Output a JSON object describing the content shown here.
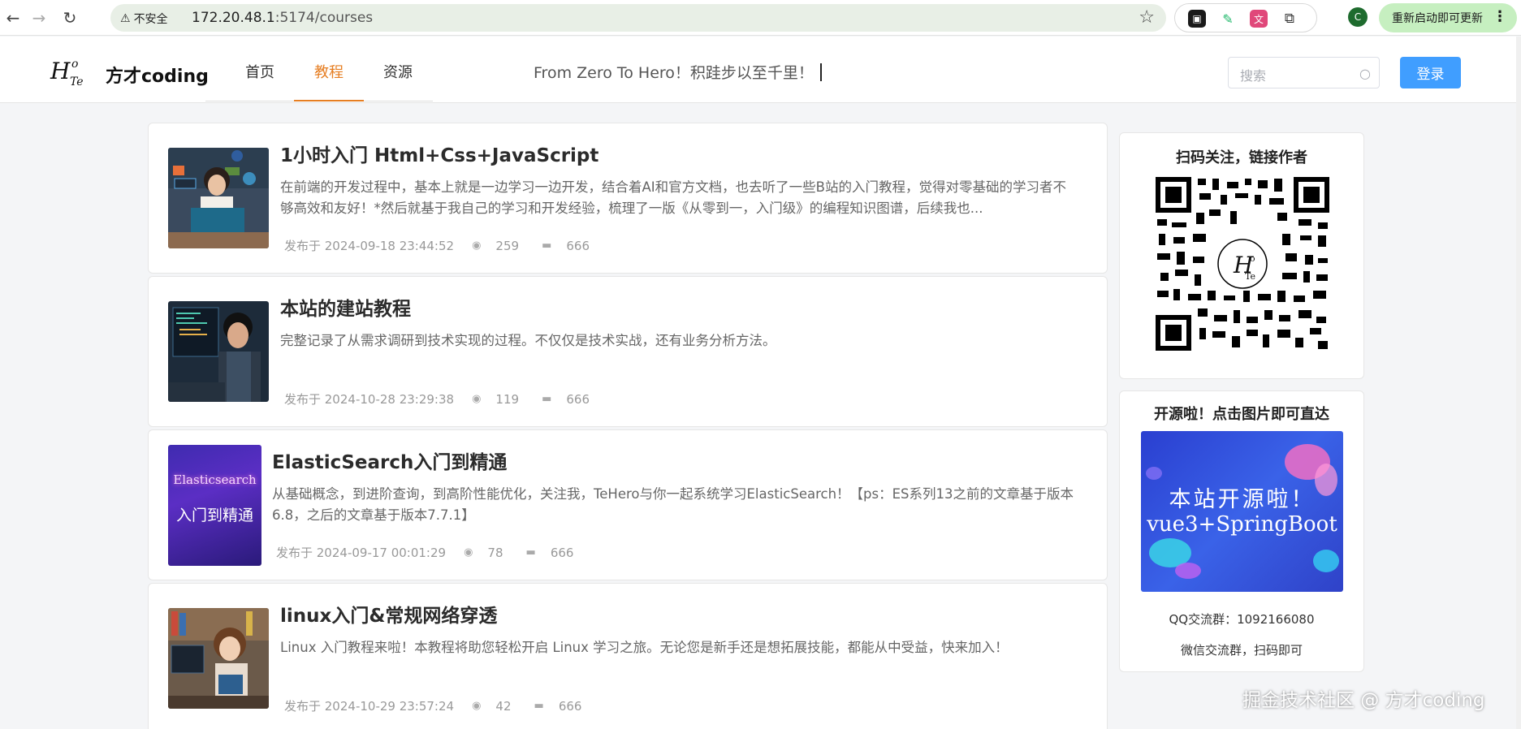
{
  "browser": {
    "insecure_label": "不安全",
    "url_host": "172.20.48.1",
    "url_rest": ":5174/courses",
    "profile_initial": "C",
    "restart_label": "重新启动即可更新"
  },
  "site": {
    "name": "方才coding",
    "nav": [
      {
        "label": "首页"
      },
      {
        "label": "教程",
        "active": true
      },
      {
        "label": "资源"
      }
    ],
    "slogan": "From Zero To Hero！积跬步以至千里！",
    "search_placeholder": "搜索",
    "login_label": "登录"
  },
  "articles": [
    {
      "title": "1小时入门 Html+Css+JavaScript",
      "desc": "在前端的开发过程中，基本上就是一边学习一边开发，结合着AI和官方文档，也去听了一些B站的入门教程，觉得对零基础的学习者不够高效和友好！*然后就基于我自己的学习和开发经验，梳理了一版《从零到一，入门级》的编程知识图谱，后续我也...",
      "published": "发布于 2024-09-18 23:44:52",
      "views": "259",
      "comments": "666",
      "thumb_icon": "coding-girl-illustration"
    },
    {
      "title": "本站的建站教程",
      "desc": "完整记录了从需求调研到技术实现的过程。不仅仅是技术实战，还有业务分析方法。",
      "published": "发布于 2024-10-28 23:29:38",
      "views": "119",
      "comments": "666",
      "thumb_icon": "developer-illustration"
    },
    {
      "title": "ElasticSearch入门到精通",
      "desc": "从基础概念，到进阶查询，到高阶性能优化，关注我，TeHero与你一起系统学习ElasticSearch！【ps：ES系列13之前的文章基于版本6.8，之后的文章基于版本7.7.1】",
      "published": "发布于 2024-09-17 00:01:29",
      "views": "78",
      "comments": "666",
      "thumb_text_1": "Elasticsearch",
      "thumb_text_2": "入门到精通"
    },
    {
      "title": "linux入门&常规网络穿透",
      "desc": "Linux 入门教程来啦！本教程将助您轻松开启 Linux 学习之旅。无论您是新手还是想拓展技能，都能从中受益，快来加入！",
      "published": "发布于 2024-10-29 23:57:24",
      "views": "42",
      "comments": "666",
      "thumb_icon": "study-girl-illustration"
    }
  ],
  "sidebar": {
    "qr_title": "扫码关注，链接作者",
    "open_title": "开源啦！点击图片即可直达",
    "promo_line1": "本站开源啦！",
    "promo_line2": "vue3+SpringBoot",
    "qq_group": "QQ交流群：1092166080",
    "wechat_group": "微信交流群，扫码即可"
  },
  "watermark": "掘金技术社区 @ 方才coding",
  "colors": {
    "accent": "#e67e22",
    "primary": "#409eff",
    "page_bg": "#f4f5f7"
  }
}
